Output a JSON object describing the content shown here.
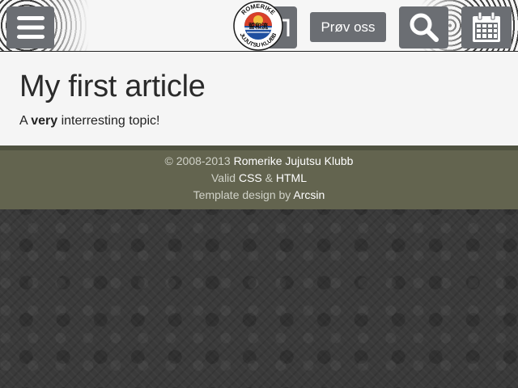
{
  "header": {
    "try_label": "Prøv oss",
    "logo": {
      "top_text": "ROMERIKE",
      "bottom_text": "JUJUTSU KLUBB",
      "center_text": "誓和流"
    },
    "icons": {
      "menu": "menu-icon",
      "partial": "partial-icon",
      "search": "search-icon",
      "calendar": "calendar-icon"
    },
    "colors": {
      "button": "#6b6e73",
      "header_bg": "#f6f6f6"
    }
  },
  "article": {
    "title": "My first article",
    "text_prefix": "A ",
    "text_bold": "very",
    "text_suffix": " interresting topic!"
  },
  "footer": {
    "copyright_prefix": "© 2008-2013 ",
    "club_link": "Romerike Jujutsu Klubb",
    "valid_prefix": "Valid ",
    "css_link": "CSS",
    "amp": " & ",
    "html_link": "HTML",
    "template_prefix": "Template design by ",
    "designer_link": "Arcsin",
    "colors": {
      "bg": "#63644f",
      "text": "#d0d2c8",
      "link": "#ffffff"
    }
  }
}
